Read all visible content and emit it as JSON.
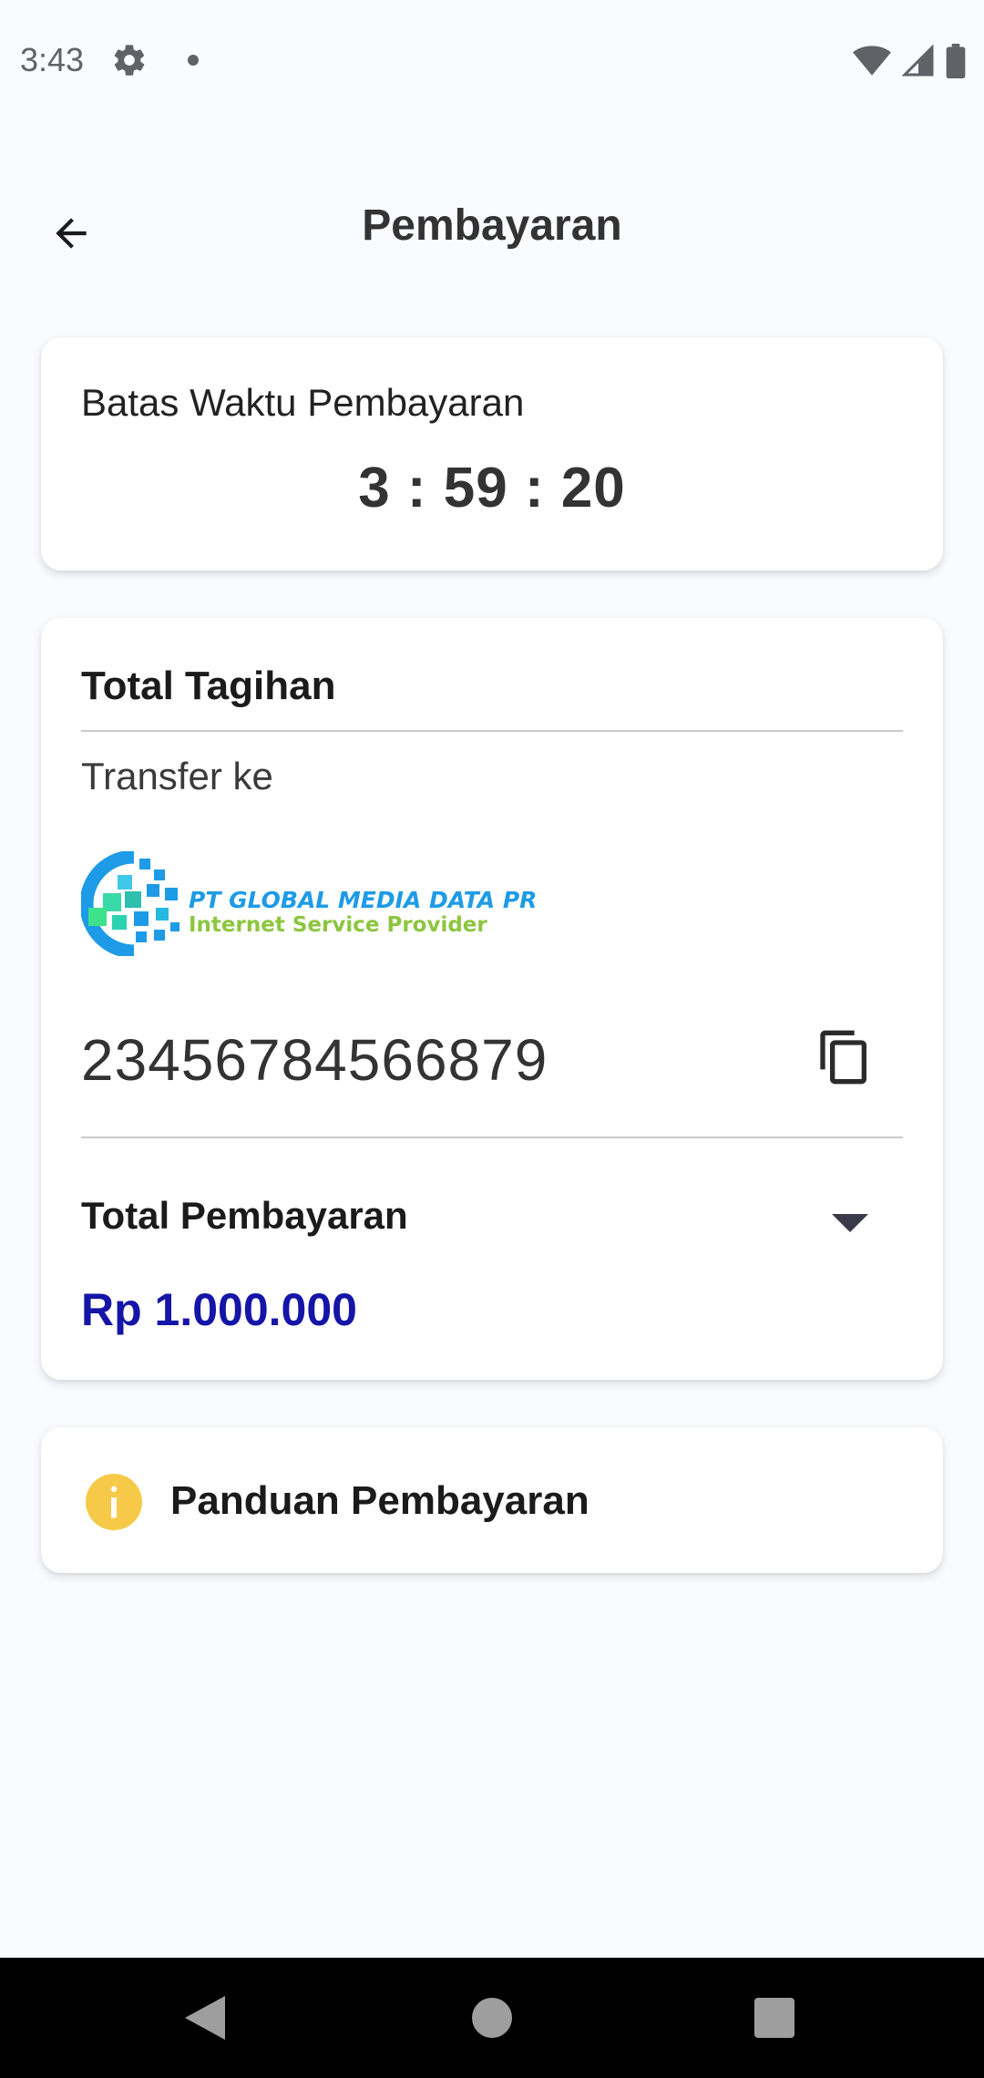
{
  "status_bar": {
    "time": "3:43",
    "icons": [
      "gear-icon",
      "notification-dot-icon",
      "wifi-icon",
      "cell-signal-icon",
      "battery-icon"
    ]
  },
  "app_bar": {
    "title": "Pembayaran",
    "back_icon": "arrow-back-icon"
  },
  "deadline_card": {
    "label": "Batas Waktu Pembayaran",
    "timer": "3 : 59 : 20"
  },
  "bill_card": {
    "title": "Total Tagihan",
    "transfer_label": "Transfer ke",
    "logo": {
      "company": "PT GLOBAL MEDIA DATA PRIMA",
      "tagline": "Internet Service Provider"
    },
    "account_number": "23456784566879",
    "copy_icon": "copy-icon",
    "total_label": "Total Pembayaran",
    "total_amount": "Rp 1.000.000",
    "dropdown_icon": "dropdown-arrow-icon"
  },
  "guide_card": {
    "label": "Panduan Pembayaran",
    "icon": "info-icon"
  },
  "nav_bar": {
    "icons": [
      "back-triangle-icon",
      "home-circle-icon",
      "recents-square-icon"
    ]
  },
  "colors": {
    "background": "#fafbfe",
    "amount_blue": "#1515a8",
    "info_yellow": "#f7c948",
    "logo_blue": "#1e9be6",
    "logo_green": "#8cc63f"
  }
}
